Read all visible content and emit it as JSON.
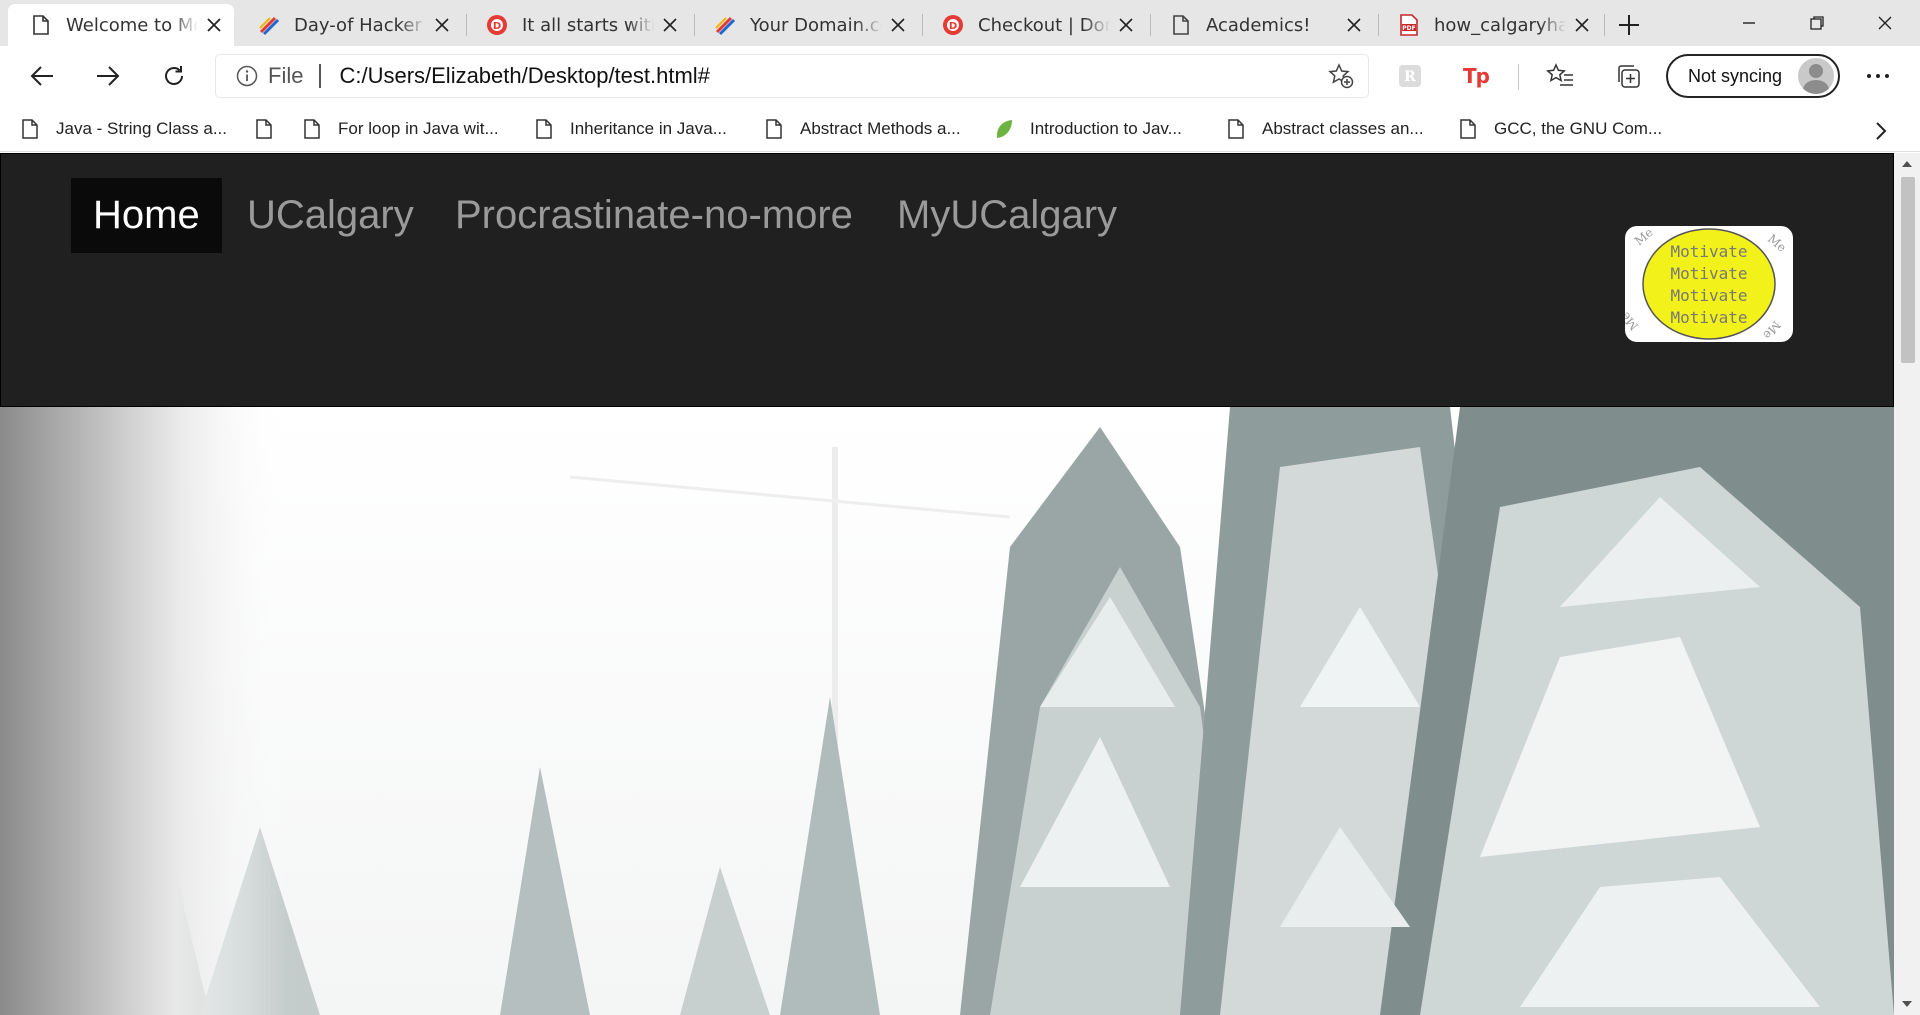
{
  "tabs": [
    {
      "title": "Welcome to Motivate Me",
      "icon": "page-icon",
      "active": true
    },
    {
      "title": "Day-of Hacker Info",
      "icon": "devpost-icon"
    },
    {
      "title": "It all starts with a domain",
      "icon": "domain-com-icon"
    },
    {
      "title": "Your Domain.com",
      "icon": "devpost-icon"
    },
    {
      "title": "Checkout | Domain.com",
      "icon": "domain-com-icon"
    },
    {
      "title": "Academics!",
      "icon": "page-icon"
    },
    {
      "title": "how_calgaryhacks",
      "icon": "pdf-icon"
    }
  ],
  "toolbar": {
    "url_scheme": "File",
    "url": "C:/Users/Elizabeth/Desktop/test.html#",
    "profile_label": "Not syncing",
    "tp_label": "Tp"
  },
  "bookmarks": {
    "items": [
      {
        "label": "Java - String Class a...",
        "icon": "page-icon"
      },
      {
        "label": "",
        "icon": "page-icon"
      },
      {
        "label": "For loop in Java wit...",
        "icon": "page-icon"
      },
      {
        "label": "Inheritance in Java...",
        "icon": "page-icon"
      },
      {
        "label": "Abstract Methods a...",
        "icon": "page-icon"
      },
      {
        "label": "Introduction to Jav...",
        "icon": "leaf-icon"
      },
      {
        "label": "Abstract classes an...",
        "icon": "page-icon"
      },
      {
        "label": "GCC, the GNU Com...",
        "icon": "page-icon"
      }
    ]
  },
  "site": {
    "nav": {
      "home": "Home",
      "ucalgary": "UCalgary",
      "procrastinate": "Procrastinate-no-more",
      "myucalgary": "MyUCalgary"
    },
    "logo": {
      "word": "Motivate",
      "ring_word": "Me",
      "circle_color": "#f2f21a"
    }
  },
  "colors": {
    "nav_bg": "#202020",
    "nav_active_bg": "#0a0a0a",
    "tab_strip": "#e6e6e6",
    "tp_red": "#e53935"
  }
}
